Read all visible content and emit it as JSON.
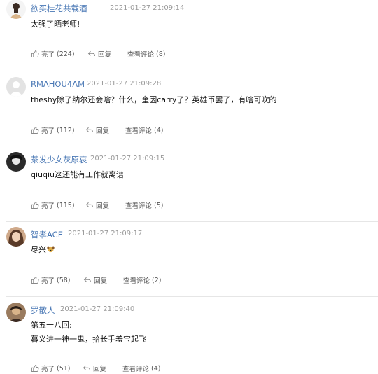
{
  "actions": {
    "like_prefix": "亮了",
    "reply_label": "回复",
    "view_prefix": "查看评论"
  },
  "comments": [
    {
      "username": "欲买桂花共载酒",
      "time": "2021-01-27 21:09:14",
      "lines": [
        "太强了晒老师!"
      ],
      "likes": "(224)",
      "view_count": "(8)"
    },
    {
      "username": "RMAHOU4AM",
      "time": "2021-01-27 21:09:28",
      "lines": [
        "theshy除了纳尔还会啥？什么，奎因carry了？英雄币罢了，有啥可吹的"
      ],
      "likes": "(112)",
      "view_count": "(4)"
    },
    {
      "username": "茶发少女灰原哀",
      "time": "2021-01-27 21:09:15",
      "lines": [
        "qiuqiu这还能有工作就离谱"
      ],
      "likes": "(115)",
      "view_count": "(5)"
    },
    {
      "username": "智孝ACE",
      "time": "2021-01-27 21:09:17",
      "lines": [
        "尽兴"
      ],
      "emoji": "dog-emoji",
      "likes": "(58)",
      "view_count": "(2)"
    },
    {
      "username": "罗散人",
      "time": "2021-01-27 21:09:40",
      "lines": [
        "第五十八回:",
        "暮义进一神一鬼，拾长手羞宝起飞"
      ],
      "likes": "(51)",
      "view_count": "(4)"
    }
  ]
}
